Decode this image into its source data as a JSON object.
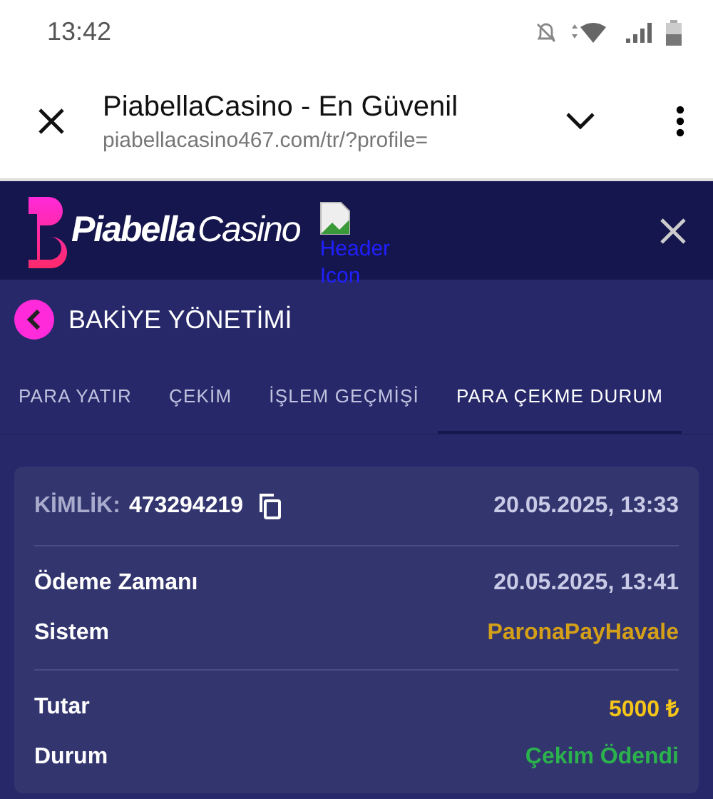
{
  "status_bar": {
    "time": "13:42"
  },
  "browser": {
    "title": "PiabellaCasino - En Güvenil",
    "url": "piabellacasino467.com/tr/?profile="
  },
  "header": {
    "logo_bold": "Piabella",
    "logo_light": "Casino",
    "broken_image_alt": "Header Icon"
  },
  "page_title": "BAKİYE YÖNETİMİ",
  "tabs": [
    {
      "label": "PARA YATIR",
      "selected": false
    },
    {
      "label": "ÇEKİM",
      "selected": false
    },
    {
      "label": "İŞLEM GEÇMİŞİ",
      "selected": false
    },
    {
      "label": "PARA ÇEKME DURUM",
      "selected": true
    }
  ],
  "card": {
    "id_label": "KİMLİK:",
    "id_value": "473294219",
    "created": "20.05.2025, 13:33",
    "sections": [
      [
        {
          "label": "Ödeme Zamanı",
          "value": "20.05.2025, 13:41",
          "color": "#c9cbe6"
        },
        {
          "label": "Sistem",
          "value": "ParonaPayHavale",
          "color": "#d4a017"
        }
      ],
      [
        {
          "label": "Tutar",
          "value": "5000 ₺",
          "color": "#f5c518"
        },
        {
          "label": "Durum",
          "value": "Çekim Ödendi",
          "color": "#2bb24c"
        }
      ]
    ]
  }
}
